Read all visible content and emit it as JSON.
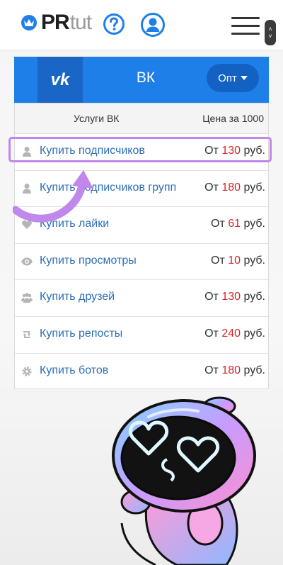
{
  "header": {
    "logo_pr": "PR",
    "logo_tut": "tut",
    "icons": [
      "crown-icon",
      "question-circle-icon",
      "user-circle-icon",
      "hamburger-menu-icon"
    ]
  },
  "panel": {
    "logo_text": "vk",
    "title": "ВК",
    "opt_label": "Опт"
  },
  "table": {
    "headers": {
      "service": "Услуги ВК",
      "price": "Цена за 1000"
    },
    "rows": [
      {
        "icon": "user-icon",
        "label": "Купить подписчиков",
        "prefix": "От",
        "price": "130",
        "unit": "руб."
      },
      {
        "icon": "user-icon",
        "label": "Купить подписчиков групп",
        "prefix": "От",
        "price": "180",
        "unit": "руб."
      },
      {
        "icon": "heart-icon",
        "label": "Купить лайки",
        "prefix": "От",
        "price": "61",
        "unit": "руб."
      },
      {
        "icon": "eye-icon",
        "label": "Купить просмотры",
        "prefix": "От",
        "price": "10",
        "unit": "руб."
      },
      {
        "icon": "users-icon",
        "label": "Купить друзей",
        "prefix": "От",
        "price": "130",
        "unit": "руб."
      },
      {
        "icon": "retweet-icon",
        "label": "Купить репосты",
        "prefix": "От",
        "price": "240",
        "unit": "руб."
      },
      {
        "icon": "gear-icon",
        "label": "Купить ботов",
        "prefix": "От",
        "price": "180",
        "unit": "руб."
      }
    ]
  },
  "colors": {
    "accent": "#1e7fe8",
    "accent_dark": "#1461c4",
    "link": "#2d6fb6",
    "price": "#d8262b",
    "highlight": "#c087ec"
  }
}
